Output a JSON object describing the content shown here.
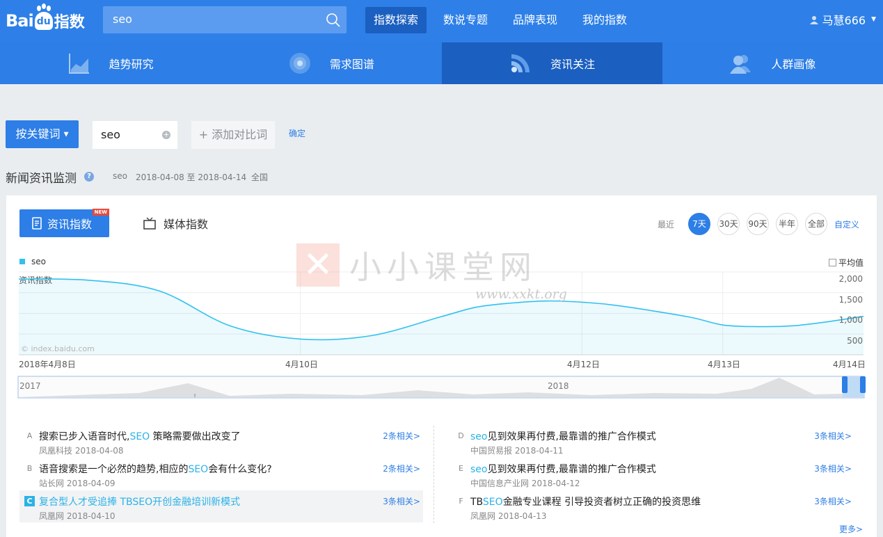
{
  "brand": {
    "bai": "Bai",
    "du": "du",
    "zhishu": "指数"
  },
  "search": {
    "query": "seo"
  },
  "top_nav": [
    "指数探索",
    "数说专题",
    "品牌表现",
    "我的指数"
  ],
  "user": {
    "name": "马慧666"
  },
  "sub_nav": [
    "趋势研究",
    "需求图谱",
    "资讯关注",
    "人群画像"
  ],
  "controls": {
    "keyword_button": "按关键词",
    "keyword": "seo",
    "add_compare": "添加对比词",
    "confirm": "确定"
  },
  "section": {
    "title": "新闻资讯监测",
    "help": "?",
    "keyword": "seo",
    "date_range": "2018-04-08 至 2018-04-14",
    "region": "全国"
  },
  "tabs": {
    "news_index": "资讯指数",
    "new_badge": "NEW",
    "media_index": "媒体指数"
  },
  "range": {
    "label": "最近",
    "options": [
      "7天",
      "30天",
      "90天",
      "半年",
      "全部"
    ],
    "selected": "7天",
    "custom": "自定义"
  },
  "chart_data": {
    "type": "area",
    "series": [
      {
        "name": "seo",
        "values": [
          1830,
          1800,
          1540,
          700,
          380,
          460,
          920,
          1150,
          1250,
          1300,
          1270,
          1190,
          920,
          720,
          680,
          700,
          800,
          930
        ]
      }
    ],
    "x": [
      "2018-04-08 00",
      "2018-04-08 12",
      "2018-04-09 00",
      "2018-04-09 12",
      "2018-04-10 00",
      "2018-04-10 12",
      "2018-04-11 00",
      "2018-04-11 06",
      "2018-04-11 12",
      "2018-04-11 18",
      "2018-04-12 00",
      "2018-04-12 06",
      "2018-04-12 18",
      "2018-04-13 00",
      "2018-04-13 06",
      "2018-04-13 12",
      "2018-04-13 18",
      "2018-04-14 00"
    ],
    "ylabel": "资讯指数",
    "yticks": [
      "2,000",
      "1,500",
      "1,000",
      "500"
    ],
    "ylim": [
      0,
      2000
    ],
    "xtick_labels": [
      "2018年4月8日",
      "4月10日",
      "4月12日",
      "4月13日",
      "4月14日"
    ],
    "legend": "seo",
    "avg_label": "平均值",
    "color": "#31c1ee",
    "grid": true
  },
  "chart_overlay": {
    "watermark_text": "小小课堂网",
    "watermark_url": "www.xxkt.org",
    "credit": "© index.baidu.com"
  },
  "overview": {
    "labels": [
      "2017",
      "2018"
    ]
  },
  "news_left": [
    {
      "letter": "A",
      "title_pre": "搜索已步入语音时代,",
      "kw": "SEO",
      "title_post": " 策略需要做出改变了",
      "source": "凤凰科技 2018-04-08",
      "related": "2条相关>"
    },
    {
      "letter": "B",
      "title_pre": "语音搜索是一个必然的趋势,相应的",
      "kw": "SEO",
      "title_post": "会有什么变化?",
      "source": "站长网 2018-04-09",
      "related": "2条相关>"
    },
    {
      "letter": "C",
      "title_pre": "复合型人才受追捧 TBSEO开创金融培训新模式",
      "kw": "",
      "title_post": "",
      "source": "凤凰网 2018-04-10",
      "related": "3条相关>"
    }
  ],
  "news_right": [
    {
      "letter": "D",
      "title_pre": "",
      "kw": "seo",
      "title_post": "见到效果再付费,最靠谱的推广合作模式",
      "source": "中国贸易报 2018-04-11",
      "related": "3条相关>"
    },
    {
      "letter": "E",
      "title_pre": "",
      "kw": "seo",
      "title_post": "见到效果再付费,最靠谱的推广合作模式",
      "source": "中国信息产业网 2018-04-12",
      "related": "3条相关>"
    },
    {
      "letter": "F",
      "title_pre": "TB",
      "kw": "SEO",
      "title_post": "金融专业课程 引导投资者树立正确的投资思维",
      "source": "凤凰网 2018-04-13",
      "related": "3条相关>"
    }
  ],
  "more": "更多>"
}
